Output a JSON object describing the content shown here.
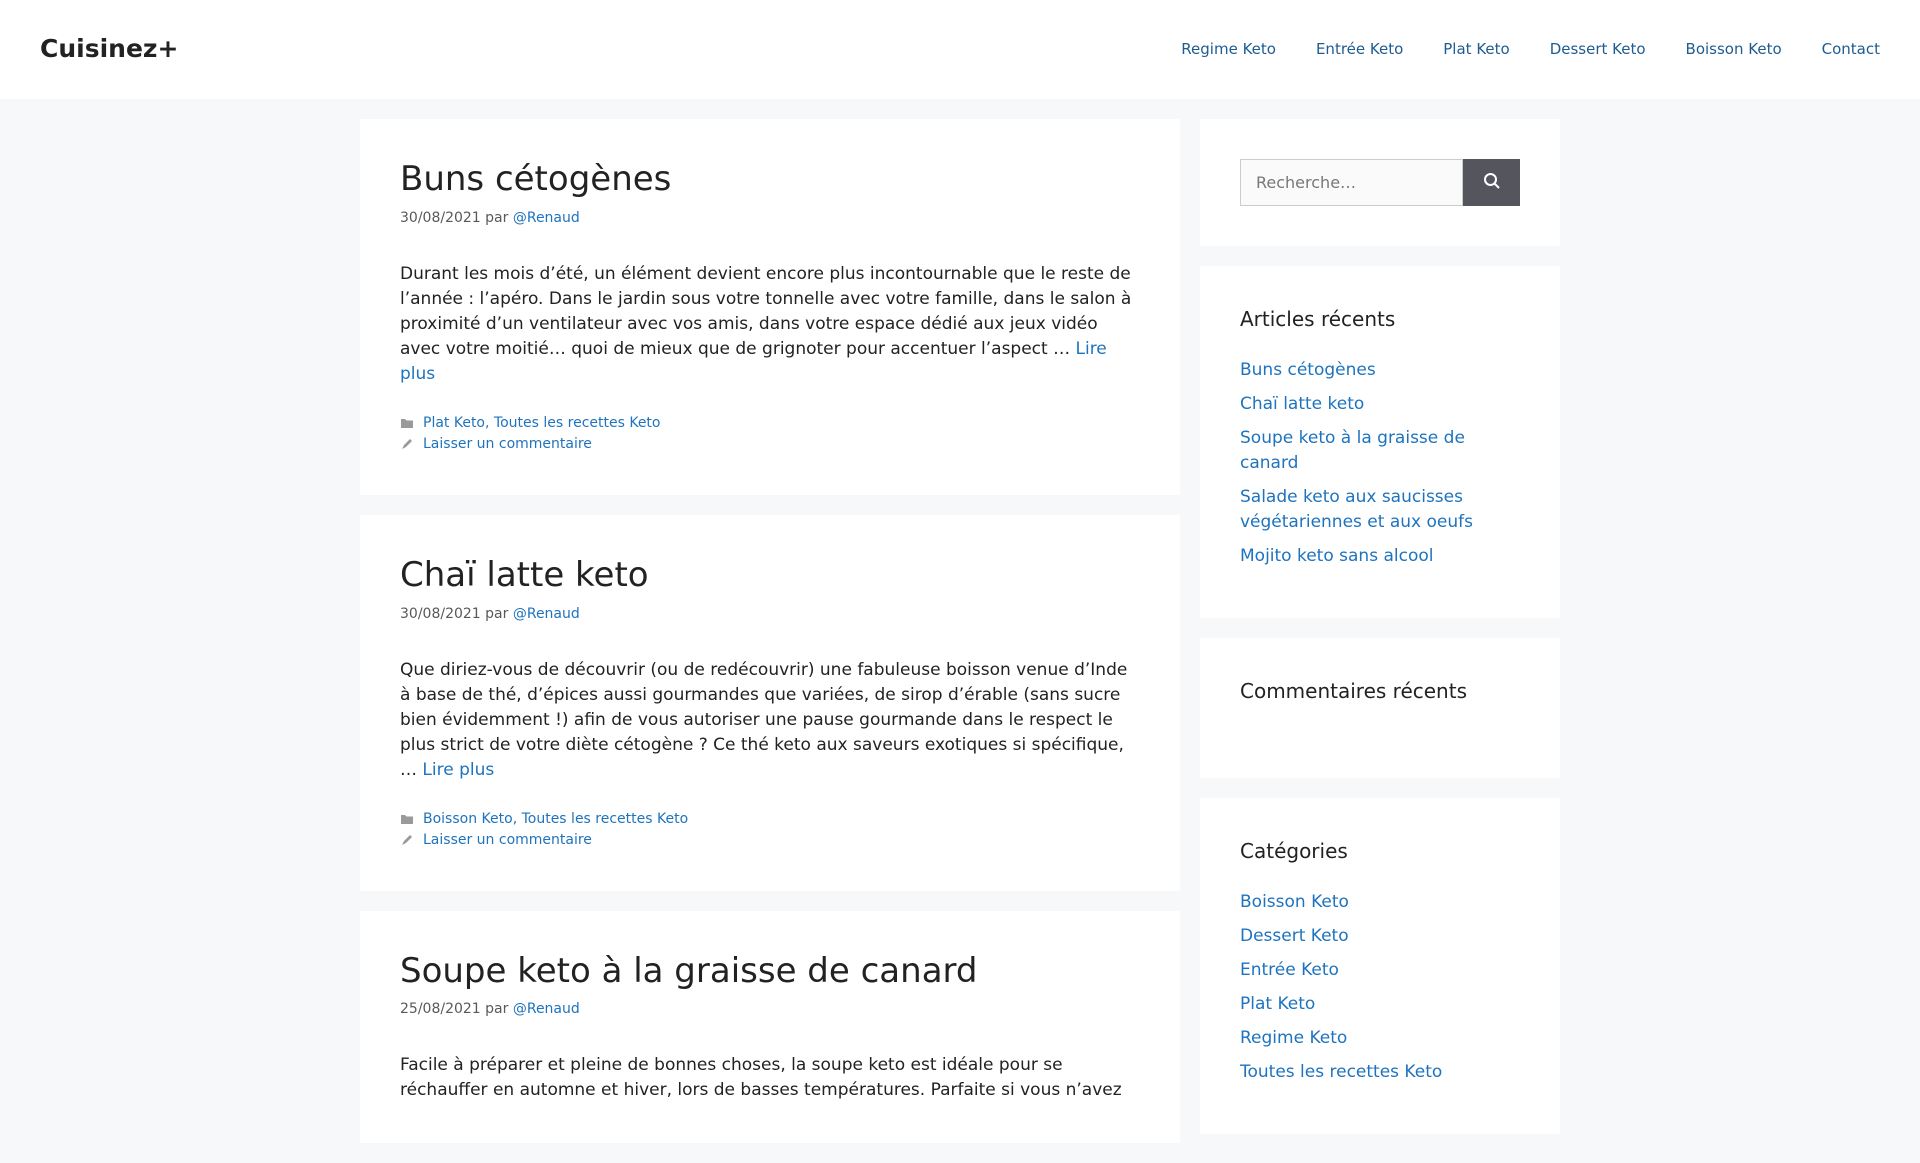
{
  "site": {
    "title": "Cuisinez+"
  },
  "nav": [
    {
      "label": "Regime Keto"
    },
    {
      "label": "Entrée Keto"
    },
    {
      "label": "Plat Keto"
    },
    {
      "label": "Dessert Keto"
    },
    {
      "label": "Boisson Keto"
    },
    {
      "label": "Contact"
    }
  ],
  "articles": [
    {
      "title": "Buns cétogènes",
      "date": "30/08/2021",
      "by": "par",
      "author": "@Renaud",
      "excerpt": "Durant les mois d’été, un élément devient encore plus incontournable que le reste de l’année : l’apéro. Dans le jardin sous votre tonnelle avec votre famille, dans le salon à proximité d’un ventilateur avec vos amis, dans votre espace dédié aux jeux vidéo avec votre moitié… quoi de mieux que de grignoter pour accentuer l’aspect …",
      "read_more": "Lire plus",
      "categories": [
        "Plat Keto",
        "Toutes les recettes Keto"
      ],
      "comment_link": "Laisser un commentaire"
    },
    {
      "title": "Chaï latte keto",
      "date": "30/08/2021",
      "by": "par",
      "author": "@Renaud",
      "excerpt": "Que diriez-vous de découvrir (ou de redécouvrir) une fabuleuse boisson venue d’Inde à base de thé, d’épices aussi gourmandes que variées, de sirop d’érable (sans sucre bien évidemment !) afin de vous autoriser une pause gourmande dans le respect le plus strict de votre diète cétogène ? Ce thé keto aux saveurs exotiques si spécifique, …",
      "read_more": "Lire plus",
      "categories": [
        "Boisson Keto",
        "Toutes les recettes Keto"
      ],
      "comment_link": "Laisser un commentaire"
    },
    {
      "title": "Soupe keto à la graisse de canard",
      "date": "25/08/2021",
      "by": "par",
      "author": "@Renaud",
      "excerpt": "Facile à préparer et pleine de bonnes choses, la soupe keto est idéale pour se réchauffer en automne et hiver, lors de basses températures. Parfaite si vous n’avez",
      "read_more": "",
      "categories": [],
      "comment_link": ""
    }
  ],
  "search": {
    "placeholder": "Recherche…"
  },
  "recent_posts": {
    "title": "Articles récents",
    "items": [
      "Buns cétogènes",
      "Chaï latte keto",
      "Soupe keto à la graisse de canard",
      "Salade keto aux saucisses végétariennes et aux oeufs",
      "Mojito keto sans alcool"
    ]
  },
  "recent_comments": {
    "title": "Commentaires récents"
  },
  "categories_widget": {
    "title": "Catégories",
    "items": [
      "Boisson Keto",
      "Dessert Keto",
      "Entrée Keto",
      "Plat Keto",
      "Regime Keto",
      "Toutes les recettes Keto"
    ]
  },
  "icons": {
    "folder": "folder-icon",
    "comment": "comment-icon",
    "search": "search-icon"
  },
  "colors": {
    "link": "#1e73be",
    "button": "#55555e",
    "background": "#f7f8f9"
  }
}
